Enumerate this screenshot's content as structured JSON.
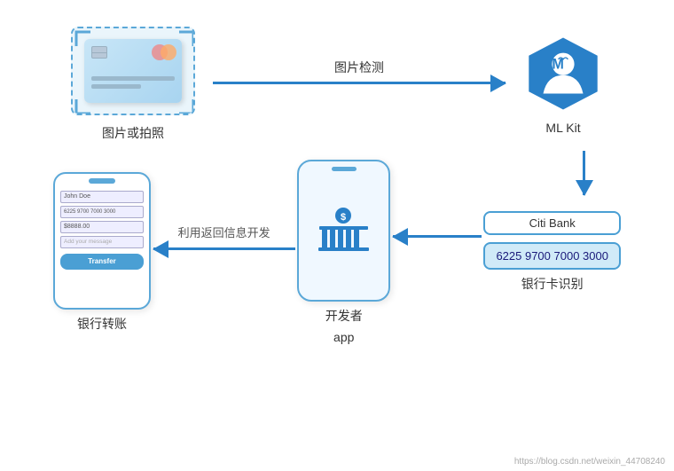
{
  "diagram": {
    "top_left_label": "图片或拍照",
    "top_arrow_label": "图片检测",
    "top_right_label": "ML Kit",
    "bottom_left_label": "银行转账",
    "bottom_arrow_label": "利用返回信息开发",
    "bottom_center_label": "开发者",
    "bottom_center_label2": "app",
    "bottom_right_label": "银行卡识别",
    "bank_name": "Citi Bank",
    "card_number": "6225 9700 7000 3000",
    "phone_name": "John Doe",
    "phone_number": "6225 9700 7000 3000",
    "phone_amount": "$8888.00",
    "phone_message": "Add your message",
    "phone_transfer": "Transfer",
    "watermark": "https://blog.csdn.net/weixin_44708240"
  }
}
